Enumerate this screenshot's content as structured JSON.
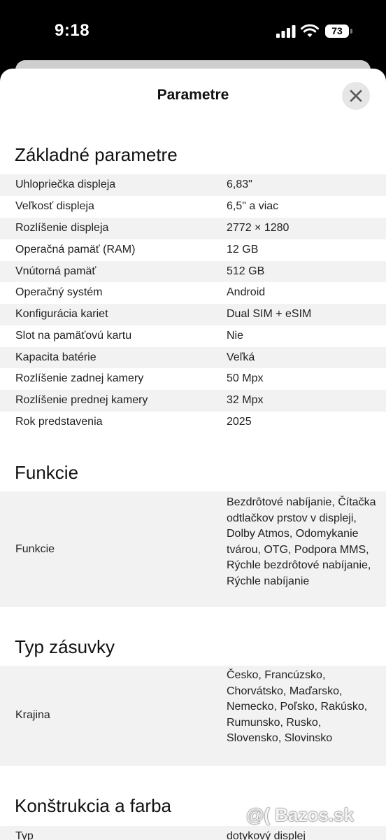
{
  "status_bar": {
    "time": "9:18",
    "battery": "73"
  },
  "sheet": {
    "title": "Parametre"
  },
  "sections": [
    {
      "title": "Základné parametre",
      "rows": [
        {
          "label": "Uhlopriečka displeja",
          "value": "6,83\""
        },
        {
          "label": "Veľkosť displeja",
          "value": "6,5\" a viac"
        },
        {
          "label": "Rozlíšenie displeja",
          "value": "2772 × 1280"
        },
        {
          "label": "Operačná pamäť (RAM)",
          "value": "12 GB"
        },
        {
          "label": "Vnútorná pamäť",
          "value": "512 GB"
        },
        {
          "label": "Operačný systém",
          "value": "Android"
        },
        {
          "label": "Konfigurácia kariet",
          "value": "Dual SIM + eSIM"
        },
        {
          "label": "Slot na pamäťovú kartu",
          "value": "Nie"
        },
        {
          "label": "Kapacita batérie",
          "value": "Veľká"
        },
        {
          "label": "Rozlíšenie zadnej kamery",
          "value": "50 Mpx"
        },
        {
          "label": "Rozlíšenie prednej kamery",
          "value": "32 Mpx"
        },
        {
          "label": "Rok predstavenia",
          "value": "2025"
        }
      ]
    },
    {
      "title": "Funkcie",
      "rows": [
        {
          "label": "Funkcie",
          "value": "Bezdrôtové nabíjanie, Čítačka odtlačkov prstov v displeji, Dolby Atmos, Odomykanie tvárou, OTG, Podpora MMS, Rýchle bezdrôtové nabíjanie, Rýchle nabíjanie"
        }
      ]
    },
    {
      "title": "Typ zásuvky",
      "rows": [
        {
          "label": "Krajina",
          "value": "Česko, Francúzsko, Chorvátsko, Maďarsko, Nemecko, Poľsko, Rakúsko, Rumunsko, Rusko, Slovensko, Slovinsko"
        }
      ]
    },
    {
      "title": "Konštrukcia a farba",
      "rows": [
        {
          "label": "Typ",
          "value": "dotykový displej"
        }
      ]
    }
  ],
  "watermark": "@( Bazos.sk"
}
